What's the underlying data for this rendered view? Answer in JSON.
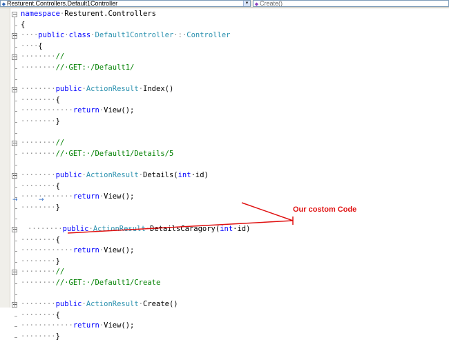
{
  "navbar": {
    "class_dropdown": "Resturent.Controllers.Default1Controller",
    "member_dropdown": "Create()"
  },
  "code": [
    {
      "indent": "",
      "tokens": [
        {
          "t": "namespace",
          "c": "kw"
        },
        {
          "t": "·",
          "c": "dt"
        },
        {
          "t": "Resturent.Controllers",
          "c": ""
        }
      ]
    },
    {
      "indent": "",
      "tokens": [
        {
          "t": "{",
          "c": ""
        }
      ]
    },
    {
      "indent": "····",
      "tokens": [
        {
          "t": "public",
          "c": "kw"
        },
        {
          "t": "·",
          "c": "dt"
        },
        {
          "t": "class",
          "c": "kw"
        },
        {
          "t": "·",
          "c": "dt"
        },
        {
          "t": "Default1Controller",
          "c": "ty"
        },
        {
          "t": "·:·",
          "c": "dt"
        },
        {
          "t": "Controller",
          "c": "ty"
        }
      ]
    },
    {
      "indent": "····",
      "tokens": [
        {
          "t": "{",
          "c": ""
        }
      ]
    },
    {
      "indent": "········",
      "tokens": [
        {
          "t": "//",
          "c": "cm"
        }
      ]
    },
    {
      "indent": "········",
      "tokens": [
        {
          "t": "//·GET:·/Default1/",
          "c": "cm"
        }
      ]
    },
    {
      "indent": "",
      "tokens": []
    },
    {
      "indent": "········",
      "tokens": [
        {
          "t": "public",
          "c": "kw"
        },
        {
          "t": "·",
          "c": "dt"
        },
        {
          "t": "ActionResult",
          "c": "ty"
        },
        {
          "t": "·",
          "c": "dt"
        },
        {
          "t": "Index()",
          "c": ""
        }
      ]
    },
    {
      "indent": "········",
      "tokens": [
        {
          "t": "{",
          "c": ""
        }
      ]
    },
    {
      "indent": "············",
      "tokens": [
        {
          "t": "return",
          "c": "kw"
        },
        {
          "t": "·",
          "c": "dt"
        },
        {
          "t": "View();",
          "c": ""
        }
      ]
    },
    {
      "indent": "········",
      "tokens": [
        {
          "t": "}",
          "c": ""
        }
      ]
    },
    {
      "indent": "",
      "tokens": []
    },
    {
      "indent": "········",
      "tokens": [
        {
          "t": "//",
          "c": "cm"
        }
      ]
    },
    {
      "indent": "········",
      "tokens": [
        {
          "t": "//·GET:·/Default1/Details/5",
          "c": "cm"
        }
      ]
    },
    {
      "indent": "",
      "tokens": []
    },
    {
      "indent": "········",
      "tokens": [
        {
          "t": "public",
          "c": "kw"
        },
        {
          "t": "·",
          "c": "dt"
        },
        {
          "t": "ActionResult",
          "c": "ty"
        },
        {
          "t": "·",
          "c": "dt"
        },
        {
          "t": "Details(",
          "c": ""
        },
        {
          "t": "int",
          "c": "kw"
        },
        {
          "t": "·id)",
          "c": ""
        }
      ]
    },
    {
      "indent": "········",
      "tokens": [
        {
          "t": "{",
          "c": ""
        }
      ]
    },
    {
      "indent": "············",
      "tokens": [
        {
          "t": "return",
          "c": "kw"
        },
        {
          "t": "·",
          "c": "dt"
        },
        {
          "t": "View();",
          "c": ""
        }
      ]
    },
    {
      "indent": "········",
      "tokens": [
        {
          "t": "}",
          "c": ""
        }
      ]
    },
    {
      "indent": "",
      "tokens": []
    },
    {
      "indent": "········",
      "tokens": [
        {
          "t": "public",
          "c": "kw"
        },
        {
          "t": "·",
          "c": "dt"
        },
        {
          "t": "ActionResult",
          "c": "ty"
        },
        {
          "t": "·",
          "c": "dt"
        },
        {
          "t": "DetailsCaragory(",
          "c": ""
        },
        {
          "t": "int",
          "c": "kw"
        },
        {
          "t": "·id)",
          "c": ""
        }
      ]
    },
    {
      "indent": "········",
      "tokens": [
        {
          "t": "{",
          "c": ""
        }
      ]
    },
    {
      "indent": "············",
      "tokens": [
        {
          "t": "return",
          "c": "kw"
        },
        {
          "t": "·",
          "c": "dt"
        },
        {
          "t": "View();",
          "c": ""
        }
      ]
    },
    {
      "indent": "········",
      "tokens": [
        {
          "t": "}",
          "c": ""
        }
      ]
    },
    {
      "indent": "········",
      "tokens": [
        {
          "t": "//",
          "c": "cm"
        }
      ]
    },
    {
      "indent": "········",
      "tokens": [
        {
          "t": "//·GET:·/Default1/Create",
          "c": "cm"
        }
      ]
    },
    {
      "indent": "",
      "tokens": []
    },
    {
      "indent": "········",
      "tokens": [
        {
          "t": "public",
          "c": "kw"
        },
        {
          "t": "·",
          "c": "dt"
        },
        {
          "t": "ActionResult",
          "c": "ty"
        },
        {
          "t": "·",
          "c": "dt"
        },
        {
          "t": "Create()",
          "c": ""
        }
      ]
    },
    {
      "indent": "········",
      "tokens": [
        {
          "t": "{",
          "c": ""
        }
      ]
    },
    {
      "indent": "············",
      "tokens": [
        {
          "t": "return",
          "c": "kw"
        },
        {
          "t": "·",
          "c": "dt"
        },
        {
          "t": "View();",
          "c": ""
        }
      ]
    },
    {
      "indent": "········",
      "tokens": [
        {
          "t": "}",
          "c": ""
        }
      ]
    }
  ],
  "annotation": {
    "callout_text": "Our costom Code",
    "color": "#e01010"
  }
}
